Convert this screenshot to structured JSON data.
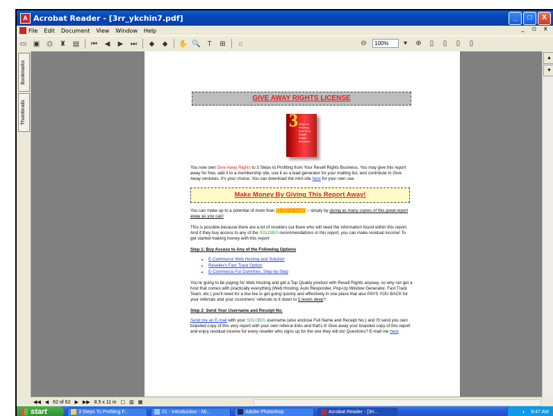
{
  "window": {
    "title": "Acrobat Reader - [3rr_ykchin7.pdf]",
    "controls": [
      "_",
      "□",
      "X"
    ]
  },
  "menubar": {
    "items": [
      "File",
      "Edit",
      "Document",
      "View",
      "Window",
      "Help"
    ],
    "doc_controls": "_ ▫ x"
  },
  "toolbar": {
    "zoom": "100%"
  },
  "side_tabs": {
    "bookmarks": "Bookmarks",
    "thumbnails": "Thumbnails"
  },
  "pdf": {
    "banner_title": "GIVE AWAY RIGHTS LICENSE",
    "cover_number": "3",
    "cover_text": "Steps to Profiting from Your Resell Rights Business",
    "p1_a": "You now own ",
    "p1_red": "Give Away Rights",
    "p1_b": " to 3 Steps to Profiting from Your Resell Rights Business. You may give this report away for free, add it to a membership site, use it as a lead generator for your mailing list, and contribute to Give Away ventures. It's your choice. You can download the mini-site ",
    "p1_link": "here",
    "p1_c": " for your own use.",
    "banner_money": "Make Money By Giving This Report Away!",
    "p2_a": "You can make up to a potential of more than ",
    "p2_hl": "$9,000 a month",
    "p2_b": " – simply by ",
    "p2_ul": "giving as many copies of this great report away as you can!",
    "p3_a": "This is possible because there are a lot of resellers out there who will need the information found within this report. And if they buy access to any of the ",
    "p3_brand": "SOLOBIS",
    "p3_b": " recommendations in this report, you can make residual income! To get started making money with this report:",
    "step1": "Step 1: Buy Access to Any of the Following Options",
    "options": [
      "E-Commerce Web Hosting and Solution",
      "Reseller's Fast Track Option",
      "E-Commerce For Dummies, Step-by-Step"
    ],
    "p4_a": "You're going to be paying for Web Hosting and get a Top Quality product with Resell Rights anyway, so why not get a host that comes with practically everything (Web Hosting, Auto Responder, Pop-Up Window Generator, Fast Track Team, etc.) you'll need for a low fee to get going quickly and effectively in one place that also PAYS YOU BACK for your referrals and your customers' referrals to it down to ",
    "p4_ul": "5 levels deep",
    "p4_b": "?",
    "step2": "Step 2: Send Your Username and Receipt No.",
    "p5_link": "Send me an E-mail",
    "p5_a": " with your ",
    "p5_brand": "SOLOBIS",
    "p5_b": " username (also enclose Full Name and Receipt No.) and I'll send you own branded copy of this very report with your own referral links and that's it! Give away your branded copy of this report and enjoy residual income for every reseller who signs up for the one they will do! Questions? E-mail me ",
    "p5_link2": "here"
  },
  "statusbar": {
    "page": "62 of 62",
    "size": "8.5 x 11 in"
  },
  "taskbar": {
    "start": "start",
    "tasks": [
      "3 Steps To Profiting F...",
      "01 - Introduction - Mi...",
      "Adobe Photoshop",
      "Acrobat Reader - [3rr..."
    ],
    "clock": "9:47 AM"
  },
  "colors": {
    "accent": "#e02020",
    "link": "#1a3fd1",
    "brand": "#2e9e2e",
    "highlight": "#ff8a00",
    "titlebar": "#0a5fd8"
  }
}
